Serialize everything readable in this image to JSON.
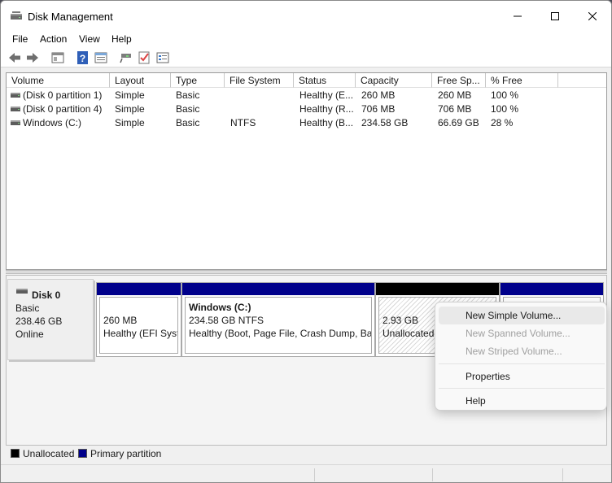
{
  "window": {
    "title": "Disk Management"
  },
  "menubar": [
    "File",
    "Action",
    "View",
    "Help"
  ],
  "toolbar": [
    "back-icon",
    "forward-icon",
    "console-tree-icon",
    "help-icon",
    "properties-icon",
    "connect-icon",
    "check-icon",
    "settings-list-icon"
  ],
  "volumes": {
    "columns": [
      "Volume",
      "Layout",
      "Type",
      "File System",
      "Status",
      "Capacity",
      "Free Sp...",
      "% Free"
    ],
    "rows": [
      [
        "(Disk 0 partition 1)",
        "Simple",
        "Basic",
        "",
        "Healthy (E...",
        "260 MB",
        "260 MB",
        "100 %"
      ],
      [
        "(Disk 0 partition 4)",
        "Simple",
        "Basic",
        "",
        "Healthy (R...",
        "706 MB",
        "706 MB",
        "100 %"
      ],
      [
        "Windows (C:)",
        "Simple",
        "Basic",
        "NTFS",
        "Healthy (B...",
        "234.58 GB",
        "66.69 GB",
        "28 %"
      ]
    ]
  },
  "disk": {
    "name": "Disk 0",
    "type": "Basic",
    "size": "238.46 GB",
    "state": "Online",
    "partitions": [
      {
        "title": "",
        "size": "260 MB",
        "status": "Healthy (EFI Syste",
        "kind": "primary"
      },
      {
        "title": "Windows  (C:)",
        "size": "234.58 GB NTFS",
        "status": "Healthy (Boot, Page File, Crash Dump, Basi",
        "kind": "primary"
      },
      {
        "title": "",
        "size": "2.93 GB",
        "status": "Unallocated",
        "kind": "unallocated"
      },
      {
        "title": "",
        "size": "",
        "status": "",
        "kind": "primary"
      }
    ]
  },
  "legend": [
    {
      "label": "Unallocated",
      "color": "#000000"
    },
    {
      "label": "Primary partition",
      "color": "#00008b"
    }
  ],
  "context_menu": {
    "items": [
      {
        "label": "New Simple Volume...",
        "enabled": true
      },
      {
        "label": "New Spanned Volume...",
        "enabled": false
      },
      {
        "label": "New Striped Volume...",
        "enabled": false
      },
      {
        "label": "Properties",
        "enabled": true
      },
      {
        "label": "Help",
        "enabled": true
      }
    ]
  }
}
